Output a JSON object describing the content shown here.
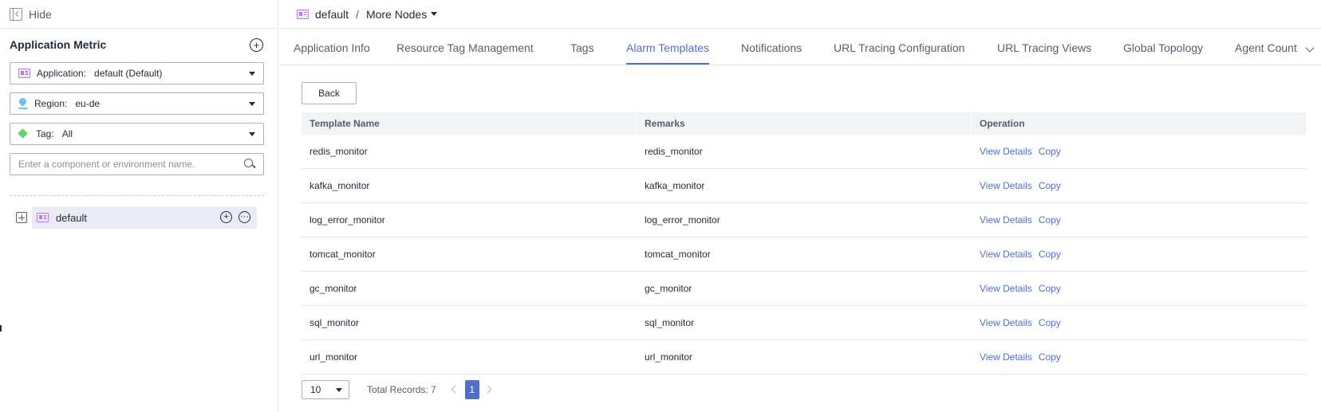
{
  "sidebar": {
    "hide_label": "Hide",
    "title": "Application Metric",
    "add_symbol": "+",
    "application": {
      "label": "Application:",
      "value": "default (Default)"
    },
    "region": {
      "label": "Region:",
      "value": "eu-de"
    },
    "tag": {
      "label": "Tag:",
      "value": "All"
    },
    "search": {
      "placeholder": "Enter a component or environment name."
    },
    "tree": {
      "node_label": "default",
      "add_symbol": "+",
      "more_symbol": "···"
    }
  },
  "breadcrumb": {
    "current": "default",
    "separator": "/",
    "more": "More Nodes"
  },
  "tabs": [
    {
      "label": "Application Info"
    },
    {
      "label": "Resource Tag Management"
    },
    {
      "label": "Tags"
    },
    {
      "label": "Alarm Templates"
    },
    {
      "label": "Notifications"
    },
    {
      "label": "URL Tracing Configuration"
    },
    {
      "label": "URL Tracing Views"
    },
    {
      "label": "Global Topology"
    },
    {
      "label": "Agent Count"
    }
  ],
  "active_tab": "Alarm Templates",
  "content": {
    "back_label": "Back",
    "columns": [
      "Template Name",
      "Remarks",
      "Operation"
    ],
    "view_details_label": "View Details",
    "copy_label": "Copy",
    "rows": [
      {
        "name": "redis_monitor",
        "remarks": "redis_monitor"
      },
      {
        "name": "kafka_monitor",
        "remarks": "kafka_monitor"
      },
      {
        "name": "log_error_monitor",
        "remarks": "log_error_monitor"
      },
      {
        "name": "tomcat_monitor",
        "remarks": "tomcat_monitor"
      },
      {
        "name": "gc_monitor",
        "remarks": "gc_monitor"
      },
      {
        "name": "sql_monitor",
        "remarks": "sql_monitor"
      },
      {
        "name": "url_monitor",
        "remarks": "url_monitor"
      }
    ]
  },
  "pagination": {
    "page_size": "10",
    "total_label": "Total Records: 7",
    "current_page": "1"
  },
  "colors": {
    "accent": "#526ecc",
    "app_icon": "#b57cf1",
    "region_icon": "#6cbfff",
    "tag_icon": "#6ad06a"
  }
}
